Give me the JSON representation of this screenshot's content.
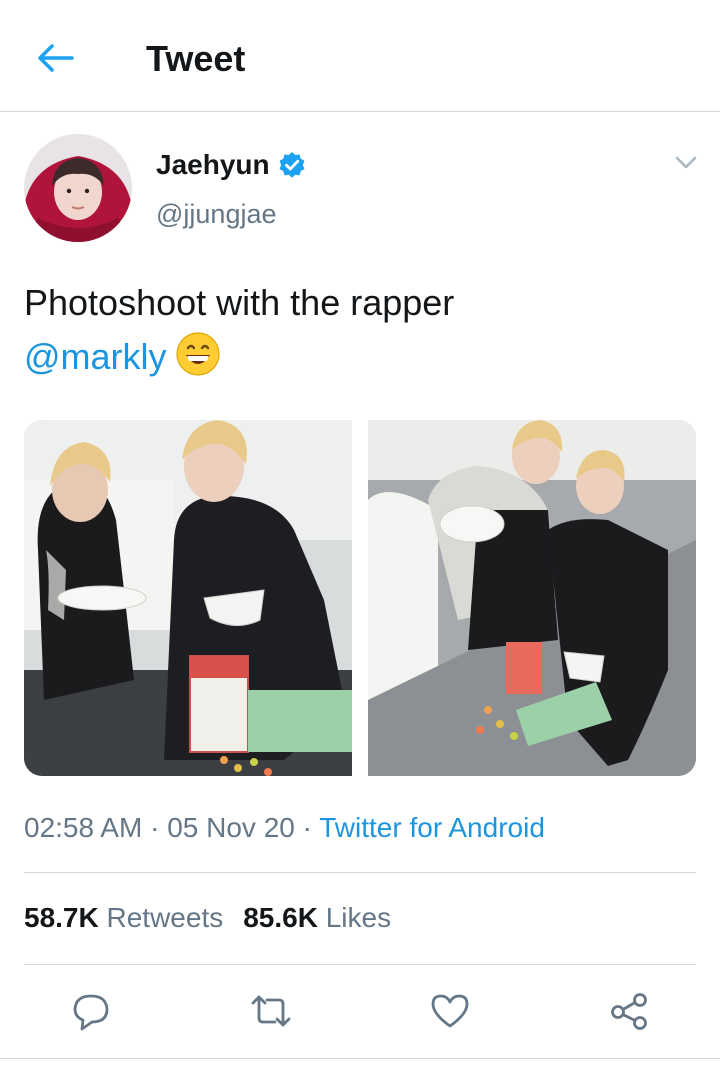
{
  "header": {
    "title": "Tweet",
    "back_icon": "back-arrow-icon"
  },
  "author": {
    "display_name": "Jaehyun",
    "handle": "@jjungjae",
    "verified": true,
    "verified_icon": "verified-badge-icon"
  },
  "tweet": {
    "text": "Photoshoot with the rapper",
    "mention": "@markly",
    "emoji": "grinning-face-emoji"
  },
  "meta": {
    "time": "02:58 AM",
    "separator": "·",
    "date": "05 Nov 20",
    "source": "Twitter for Android"
  },
  "stats": {
    "retweets_count": "58.7K",
    "retweets_label": "Retweets",
    "likes_count": "85.6K",
    "likes_label": "Likes"
  },
  "actions": [
    "reply-icon",
    "retweet-icon",
    "like-icon",
    "share-icon"
  ],
  "colors": {
    "accent": "#1b95e0",
    "text": "#14171a",
    "secondary": "#657786",
    "divider": "#cfd9de"
  }
}
